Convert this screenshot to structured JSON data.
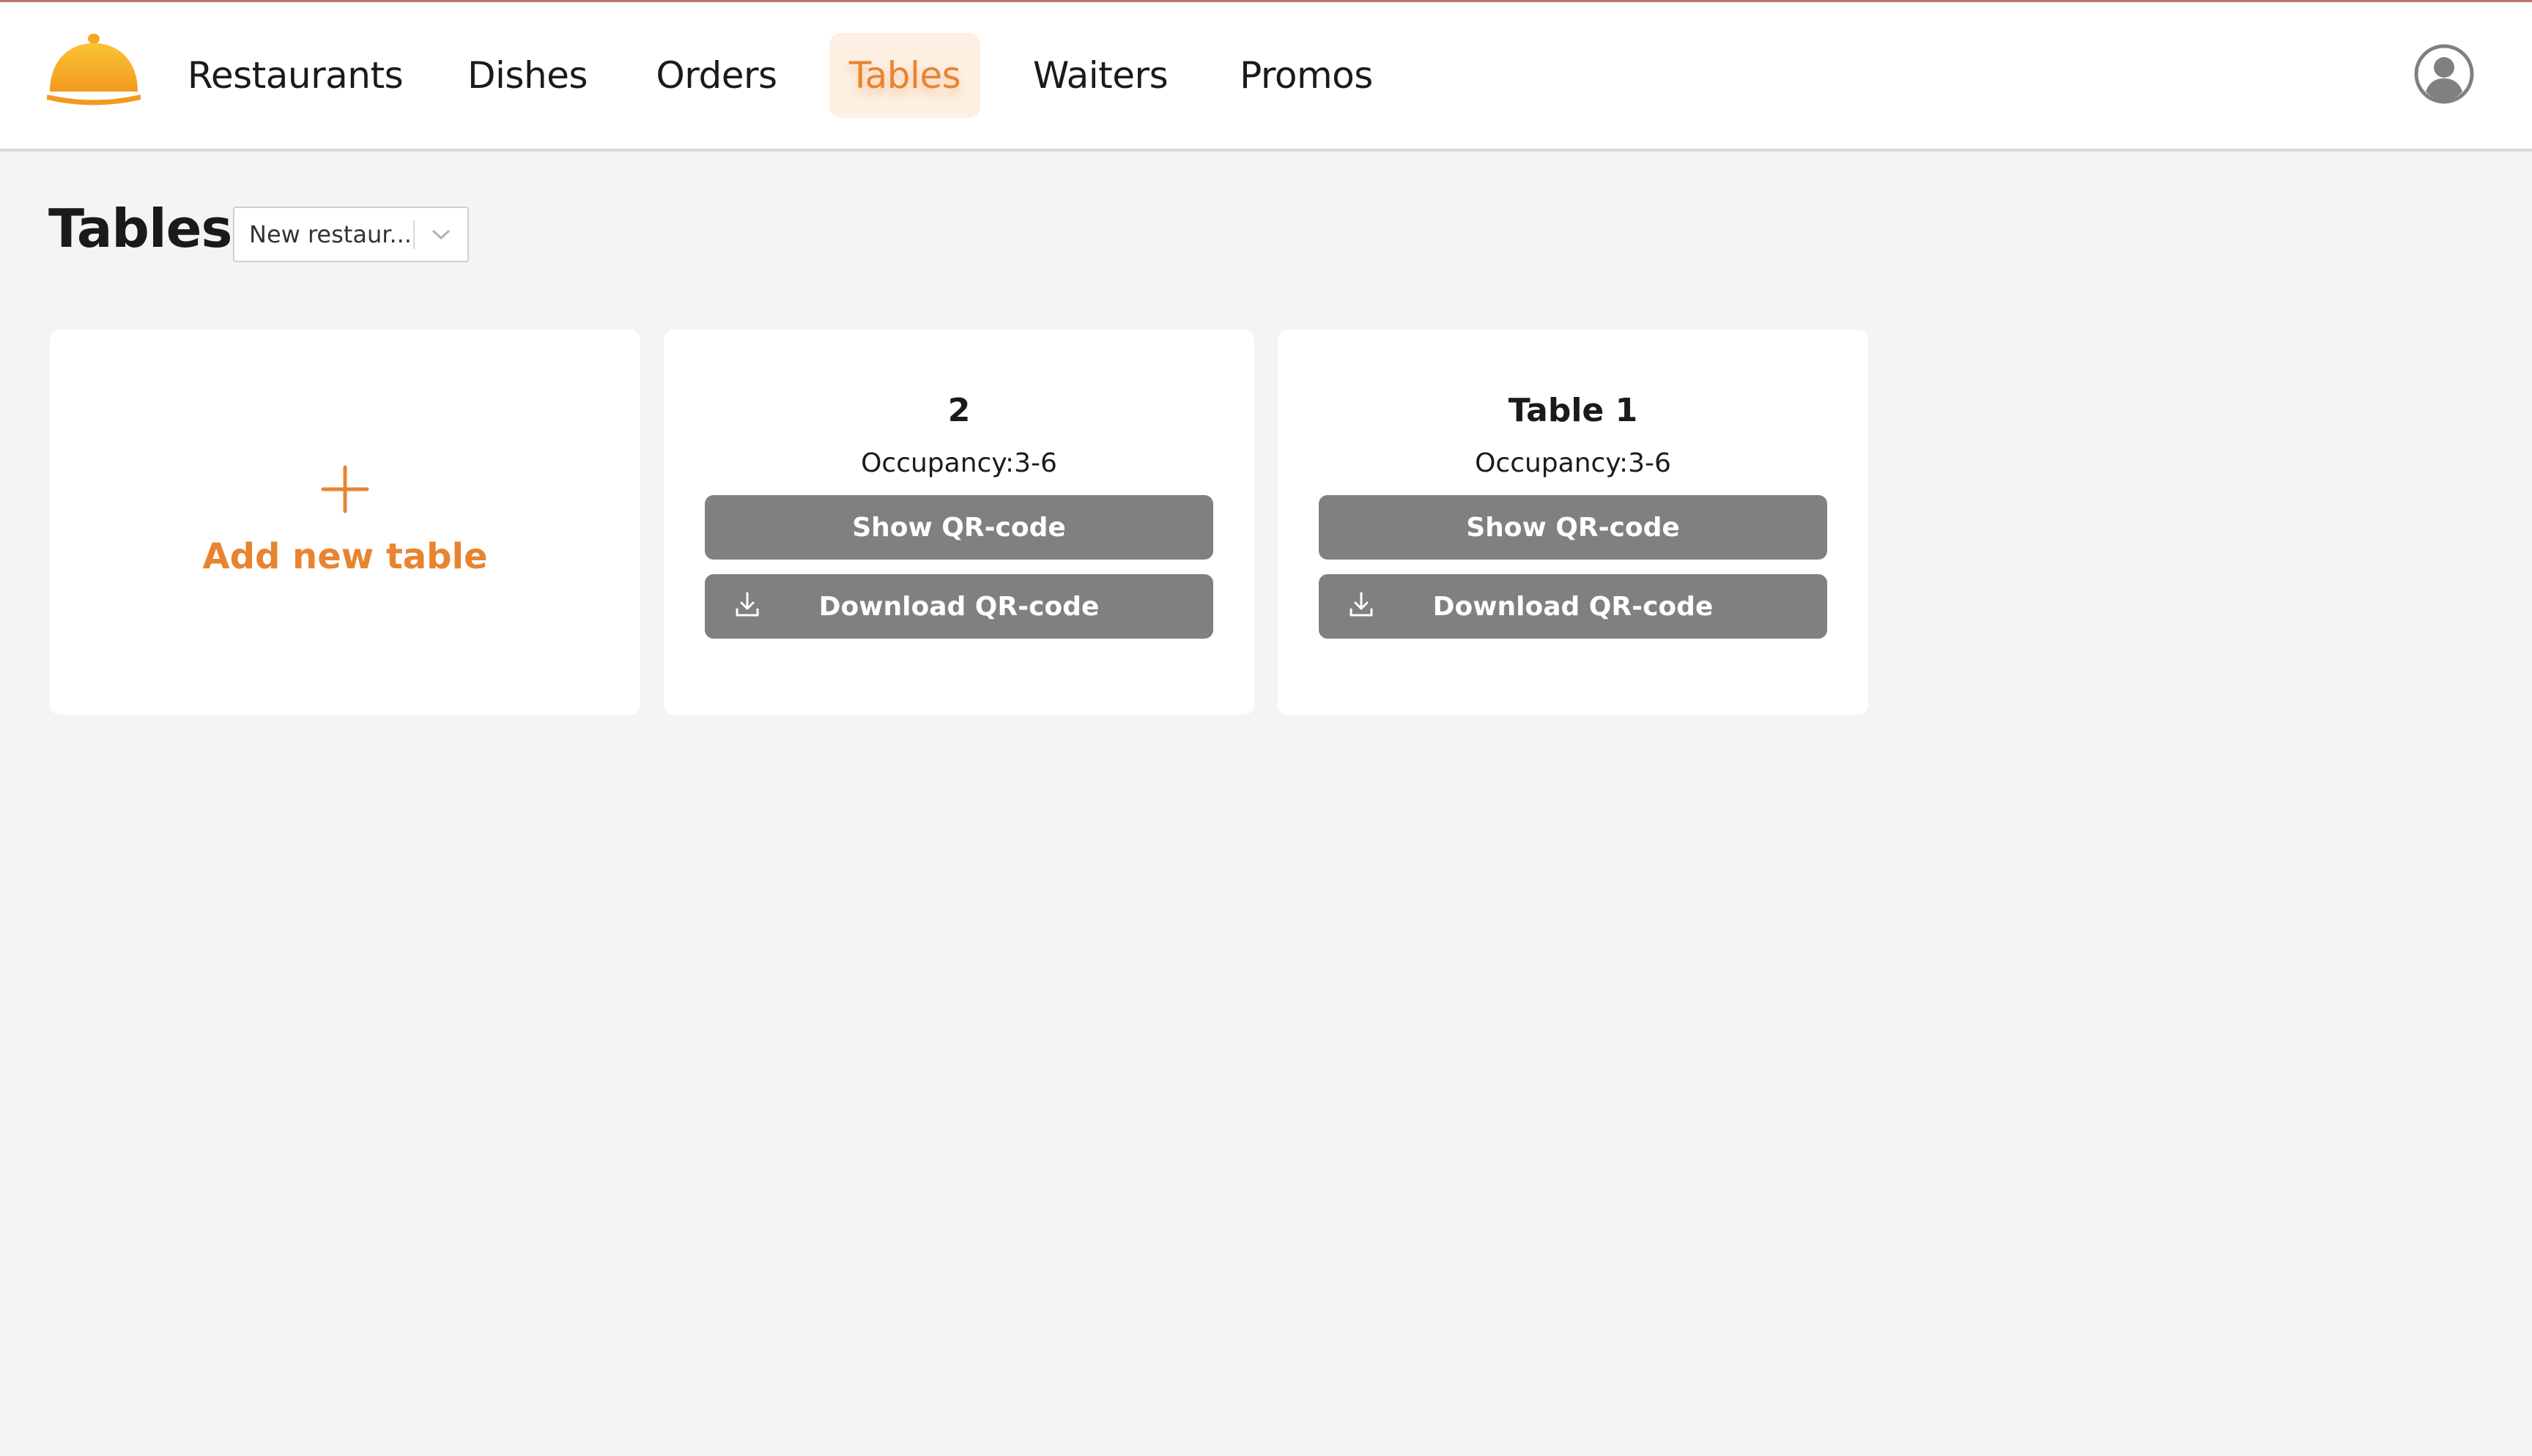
{
  "nav": {
    "items": [
      {
        "label": "Restaurants"
      },
      {
        "label": "Dishes"
      },
      {
        "label": "Orders"
      },
      {
        "label": "Tables",
        "active": true
      },
      {
        "label": "Waiters"
      },
      {
        "label": "Promos"
      }
    ]
  },
  "page": {
    "title": "Tables",
    "restaurant_select": {
      "value": "New restaur..."
    }
  },
  "add_card": {
    "label": "Add new table"
  },
  "tables": [
    {
      "name": "2",
      "occupancy": "Occupancy:3-6",
      "show_label": "Show QR-code",
      "download_label": "Download QR-code"
    },
    {
      "name": "Table 1",
      "occupancy": "Occupancy:3-6",
      "show_label": "Show QR-code",
      "download_label": "Download QR-code"
    }
  ],
  "colors": {
    "accent": "#e8842f",
    "button": "#808080",
    "background": "#f4f4f4"
  },
  "icons": {
    "logo": "cloche-icon",
    "profile": "user-circle-icon",
    "add": "plus-icon",
    "download": "download-icon",
    "dropdown": "chevron-down-icon"
  }
}
